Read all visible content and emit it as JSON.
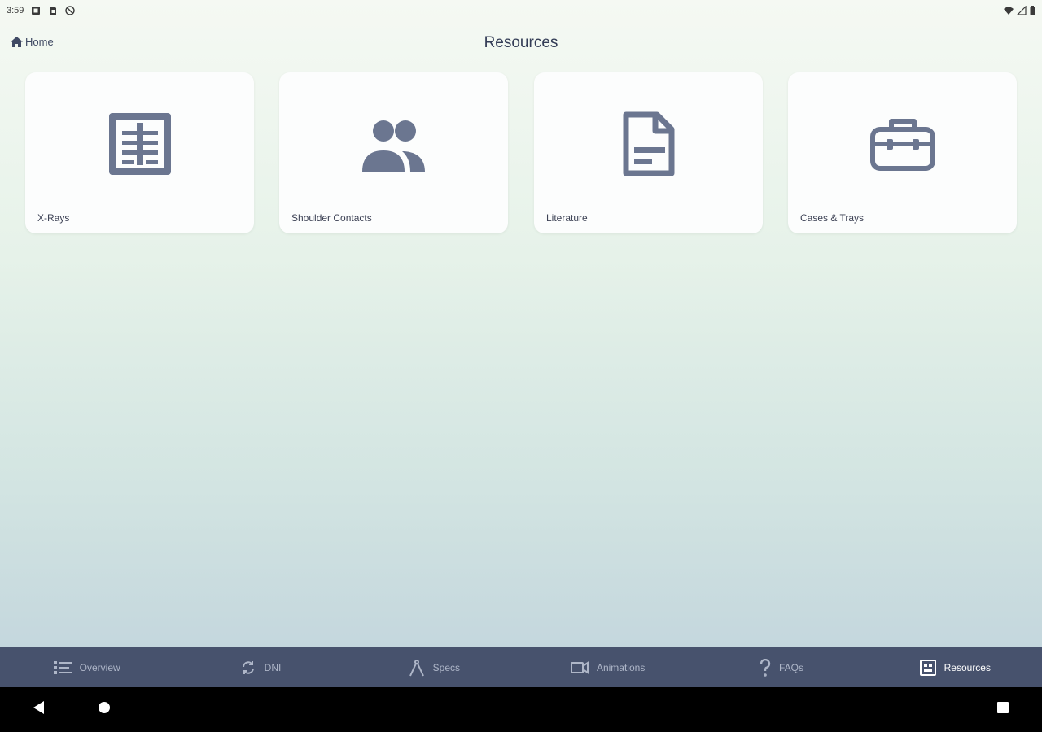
{
  "status_bar": {
    "time": "3:59",
    "icons": [
      "notification-icon",
      "sim-card-icon",
      "no-sync-icon",
      "wifi-icon",
      "signal-icon",
      "battery-icon"
    ]
  },
  "header": {
    "home_label": "Home",
    "title": "Resources"
  },
  "cards": [
    {
      "label": "X-Rays",
      "icon": "x-ray-icon"
    },
    {
      "label": "Shoulder Contacts",
      "icon": "people-icon"
    },
    {
      "label": "Literature",
      "icon": "document-icon"
    },
    {
      "label": "Cases & Trays",
      "icon": "toolbox-icon"
    }
  ],
  "bottom_nav": [
    {
      "label": "Overview",
      "icon": "list-icon",
      "active": false
    },
    {
      "label": "DNI",
      "icon": "sync-icon",
      "active": false
    },
    {
      "label": "Specs",
      "icon": "compass-icon",
      "active": false
    },
    {
      "label": "Animations",
      "icon": "video-icon",
      "active": false
    },
    {
      "label": "FAQs",
      "icon": "question-icon",
      "active": false
    },
    {
      "label": "Resources",
      "icon": "resources-icon",
      "active": true
    }
  ],
  "colors": {
    "icon": "#6b7690",
    "nav_bg": "#47526d",
    "nav_active": "#ffffff",
    "nav_inactive": "#aeb6c8"
  }
}
